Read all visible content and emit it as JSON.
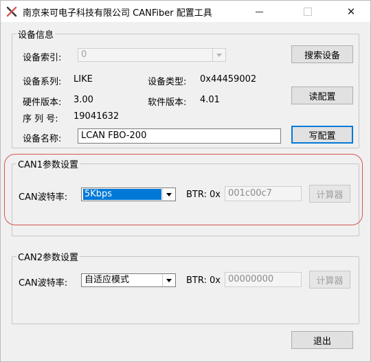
{
  "window": {
    "title": "南京来可电子科技有限公司 CANFiber 配置工具",
    "close_glyph": "✕"
  },
  "device_info": {
    "legend": "设备信息",
    "index_label": "设备索引:",
    "index_value": "0",
    "series_label": "设备系列:",
    "series_value": "LIKE",
    "type_label": "设备类型:",
    "type_value": "0x44459002",
    "hw_label": "硬件版本:",
    "hw_value": "3.00",
    "sw_label": "软件版本:",
    "sw_value": "4.01",
    "serial_label": "序 列 号:",
    "serial_value": "19041632",
    "name_label": "设备名称:",
    "name_value": "LCAN FBO-200",
    "search_button": "搜索设备",
    "read_button": "读配置",
    "write_button": "写配置"
  },
  "can1": {
    "legend": "CAN1参数设置",
    "baud_label": "CAN波特率:",
    "baud_value": "5Kbps",
    "btr_label": "BTR: 0x",
    "btr_value": "001c00c7",
    "calc_button": "计算器"
  },
  "can2": {
    "legend": "CAN2参数设置",
    "baud_label": "CAN波特率:",
    "baud_value": "自适应模式",
    "btr_label": "BTR: 0x",
    "btr_value": "00000000",
    "calc_button": "计算器"
  },
  "footer": {
    "exit_button": "退出"
  },
  "colors": {
    "highlight_ring": "#d9534f",
    "selection": "#0078d7"
  }
}
